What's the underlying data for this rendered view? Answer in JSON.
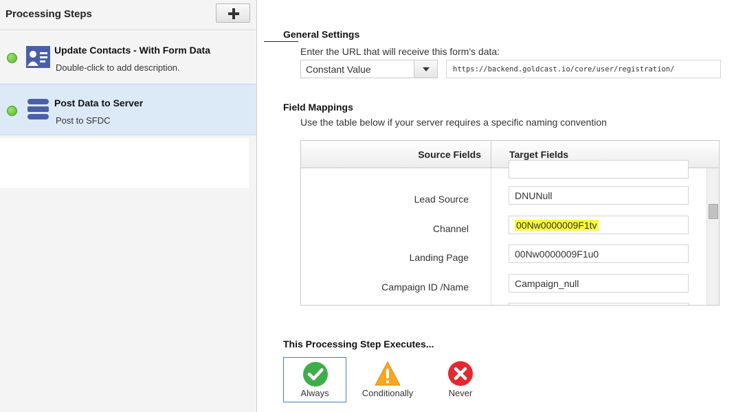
{
  "left_panel": {
    "title": "Processing Steps",
    "add_icon": "plus-icon",
    "steps": [
      {
        "name": "Update Contacts - With Form Data",
        "description": "Double-click to add description.",
        "icon": "contact-card-icon",
        "status_color": "#5cbd2e"
      },
      {
        "name": "Post Data to Server",
        "description": "Post to SFDC",
        "icon": "server-icon",
        "status_color": "#5cbd2e",
        "selected": true
      }
    ]
  },
  "general_settings": {
    "title": "General Settings",
    "helper": "Enter the URL that will receive this form's data:",
    "url_type": "Constant Value",
    "url_value": "https://backend.goldcast.io/core/user/registration/"
  },
  "field_mappings": {
    "title": "Field Mappings",
    "helper": "Use the table below if your server requires a specific naming convention",
    "headers": {
      "source": "Source Fields",
      "target": "Target Fields"
    },
    "rows": [
      {
        "source": "Lead Source",
        "target": "DNUNull"
      },
      {
        "source": "Channel",
        "target": "00Nw0000009F1tv",
        "highlighted": true
      },
      {
        "source": "Landing Page",
        "target": "00Nw0000009F1u0"
      },
      {
        "source": "Campaign ID /Name",
        "target": "Campaign_null"
      }
    ]
  },
  "execution": {
    "title": "This Processing Step Executes...",
    "options": [
      {
        "label": "Always",
        "icon": "check-circle-icon",
        "color": "#3fae49",
        "selected": true
      },
      {
        "label": "Conditionally",
        "icon": "warning-triangle-icon",
        "color": "#f5a623"
      },
      {
        "label": "Never",
        "icon": "x-circle-icon",
        "color": "#e5282d"
      }
    ]
  },
  "colors": {
    "accent_blue": "#3a7bd5",
    "selected_row": "#dce9f7",
    "highlight": "#fbfb3a",
    "icon_blue": "#4a5fa8"
  }
}
